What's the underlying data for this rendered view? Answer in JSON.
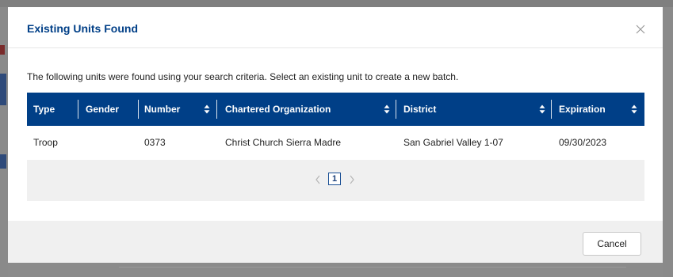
{
  "modal": {
    "title": "Existing Units Found",
    "description": "The following units were found using your search criteria. Select an existing unit to create a new batch."
  },
  "table": {
    "columns": [
      {
        "label": "Type",
        "sortable": false
      },
      {
        "label": "Gender",
        "sortable": false
      },
      {
        "label": "Number",
        "sortable": true
      },
      {
        "label": "Chartered Organization",
        "sortable": true
      },
      {
        "label": "District",
        "sortable": true
      },
      {
        "label": "Expiration",
        "sortable": true
      }
    ],
    "rows": [
      {
        "type": "Troop",
        "gender": "",
        "number": "0373",
        "chartered_organization": "Christ Church Sierra Madre",
        "district": "San Gabriel Valley 1-07",
        "expiration": "09/30/2023"
      }
    ]
  },
  "pagination": {
    "current_page": "1"
  },
  "footer": {
    "cancel_label": "Cancel"
  },
  "colors": {
    "header_bg": "#003f87",
    "title": "#003f87",
    "panel_bg": "#f0f0f0"
  },
  "icons": {
    "close": "close-icon",
    "sort": "sort-icon",
    "prev": "chevron-left-icon",
    "next": "chevron-right-icon"
  }
}
